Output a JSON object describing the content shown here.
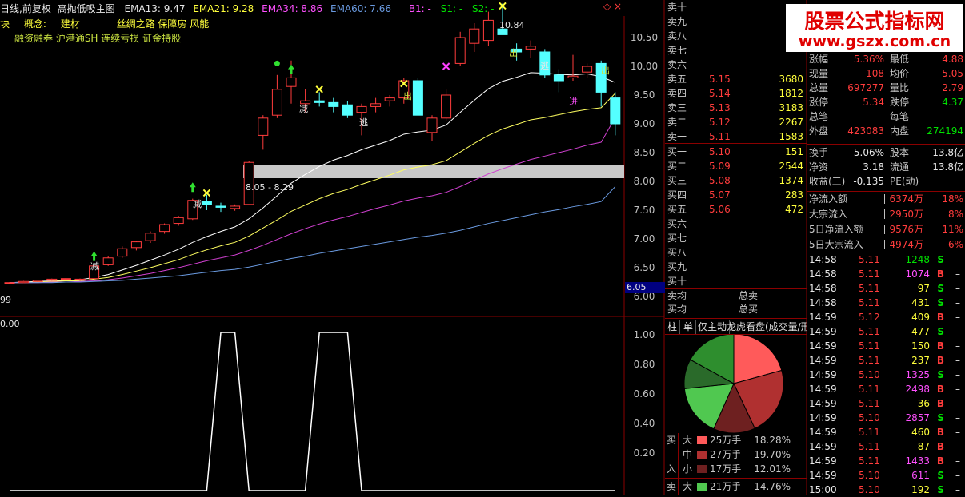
{
  "header": {
    "period": "日线,前复权",
    "indicator": "高抛低吸主图",
    "ema13": "EMA13: 9.47",
    "ema21": "EMA21: 9.28",
    "ema34": "EMA34: 8.86",
    "ema60": "EMA60: 7.66",
    "b1": "B1: -",
    "s1": "S1: -",
    "s2": "S2: -",
    "controls": "◇ ×"
  },
  "info": {
    "row1_a": "块",
    "row1_b": "概念:",
    "row1_c": "建材",
    "row1_d": "丝绸之路 保障房 风能",
    "row2": "融资融券 沪港通SH 连续亏损 证金持股"
  },
  "chart_labels": {
    "high_label": "10.84",
    "zone_label": "8.05 - 8.29",
    "left_value": "99",
    "sub_title": "0.00",
    "price_tag": "6.05",
    "marks": {
      "jian": "减",
      "tao": "逃",
      "chu": "出",
      "jin": "进"
    }
  },
  "watermark": {
    "title": "股票公式指标网",
    "url": "www.gszx.com.cn"
  },
  "price_axis": [
    "10.50",
    "10.00",
    "9.50",
    "9.00",
    "8.50",
    "8.00",
    "7.50",
    "7.00",
    "6.50",
    "6.00"
  ],
  "sub_axis": [
    "1.00",
    "0.80",
    "0.60",
    "0.40",
    "0.20"
  ],
  "orderbook": {
    "sells": [
      {
        "label": "卖十",
        "price": "",
        "vol": ""
      },
      {
        "label": "卖九",
        "price": "",
        "vol": ""
      },
      {
        "label": "卖八",
        "price": "",
        "vol": ""
      },
      {
        "label": "卖七",
        "price": "",
        "vol": ""
      },
      {
        "label": "卖六",
        "price": "",
        "vol": ""
      },
      {
        "label": "卖五",
        "price": "5.15",
        "vol": "3680"
      },
      {
        "label": "卖四",
        "price": "5.14",
        "vol": "1812"
      },
      {
        "label": "卖三",
        "price": "5.13",
        "vol": "3183"
      },
      {
        "label": "卖二",
        "price": "5.12",
        "vol": "2267"
      },
      {
        "label": "卖一",
        "price": "5.11",
        "vol": "1583"
      }
    ],
    "buys": [
      {
        "label": "买一",
        "price": "5.10",
        "vol": "151"
      },
      {
        "label": "买二",
        "price": "5.09",
        "vol": "2544"
      },
      {
        "label": "买三",
        "price": "5.08",
        "vol": "1374"
      },
      {
        "label": "买四",
        "price": "5.07",
        "vol": "283"
      },
      {
        "label": "买五",
        "price": "5.06",
        "vol": "472"
      },
      {
        "label": "买六",
        "price": "",
        "vol": ""
      },
      {
        "label": "买七",
        "price": "",
        "vol": ""
      },
      {
        "label": "买八",
        "price": "",
        "vol": ""
      },
      {
        "label": "买九",
        "price": "",
        "vol": ""
      },
      {
        "label": "买十",
        "price": "",
        "vol": ""
      }
    ],
    "avg_sell_label": "卖均",
    "total_sell_label": "总卖",
    "avg_buy_label": "买均",
    "total_buy_label": "总买"
  },
  "stats": {
    "r0": {
      "l1": "",
      "v1": "",
      "l2": "",
      "v2": ""
    },
    "r1": {
      "l1": "涨幅",
      "v1": "5.36%",
      "l2": "最低",
      "v2": "4.88"
    },
    "r2": {
      "l1": "现量",
      "v1": "108",
      "l2": "均价",
      "v2": "5.05"
    },
    "r3": {
      "l1": "总量",
      "v1": "697277",
      "l2": "量比",
      "v2": "2.79"
    },
    "r4": {
      "l1": "涨停",
      "v1": "5.34",
      "l2": "跌停",
      "v2": "4.37"
    },
    "r5": {
      "l1": "总笔",
      "v1": "-",
      "l2": "每笔",
      "v2": "-"
    },
    "r6": {
      "l1": "外盘",
      "v1": "423083",
      "l2": "内盘",
      "v2": "274194"
    },
    "r7": {
      "l1": "换手",
      "v1": "5.06%",
      "l2": "股本",
      "v2": "13.8亿"
    },
    "r8": {
      "l1": "净资",
      "v1": "3.18",
      "l2": "流通",
      "v2": "13.8亿"
    },
    "r9": {
      "l1": "收益(三)",
      "v1": "-0.135",
      "l2": "PE(动)",
      "v2": ""
    }
  },
  "flows": [
    {
      "label": "净流入额",
      "amount": "6374万",
      "pct": "18%"
    },
    {
      "label": "大宗流入",
      "amount": "2950万",
      "pct": "8%"
    },
    {
      "label": "5日净流入额",
      "amount": "9576万",
      "pct": "11%"
    },
    {
      "label": "5日大宗流入",
      "amount": "4974万",
      "pct": "6%"
    }
  ],
  "ticks": [
    {
      "time": "14:58",
      "price": "5.11",
      "vol": "1248",
      "side": "S",
      "dir": "green"
    },
    {
      "time": "14:58",
      "price": "5.11",
      "vol": "1074",
      "side": "B",
      "dir": "magenta"
    },
    {
      "time": "14:58",
      "price": "5.11",
      "vol": "97",
      "side": "S",
      "dir": "yellow"
    },
    {
      "time": "14:58",
      "price": "5.11",
      "vol": "431",
      "side": "S",
      "dir": "yellow"
    },
    {
      "time": "14:59",
      "price": "5.12",
      "vol": "409",
      "side": "B",
      "dir": "yellow"
    },
    {
      "time": "14:59",
      "price": "5.11",
      "vol": "477",
      "side": "S",
      "dir": "yellow"
    },
    {
      "time": "14:59",
      "price": "5.11",
      "vol": "150",
      "side": "B",
      "dir": "yellow"
    },
    {
      "time": "14:59",
      "price": "5.11",
      "vol": "237",
      "side": "B",
      "dir": "yellow"
    },
    {
      "time": "14:59",
      "price": "5.10",
      "vol": "1325",
      "side": "S",
      "dir": "magenta"
    },
    {
      "time": "14:59",
      "price": "5.11",
      "vol": "2498",
      "side": "B",
      "dir": "magenta"
    },
    {
      "time": "14:59",
      "price": "5.11",
      "vol": "36",
      "side": "B",
      "dir": "yellow"
    },
    {
      "time": "14:59",
      "price": "5.10",
      "vol": "2857",
      "side": "S",
      "dir": "magenta"
    },
    {
      "time": "14:59",
      "price": "5.11",
      "vol": "460",
      "side": "B",
      "dir": "yellow"
    },
    {
      "time": "14:59",
      "price": "5.11",
      "vol": "87",
      "side": "B",
      "dir": "yellow"
    },
    {
      "time": "14:59",
      "price": "5.11",
      "vol": "1433",
      "side": "B",
      "dir": "magenta"
    },
    {
      "time": "14:59",
      "price": "5.10",
      "vol": "611",
      "side": "S",
      "dir": "magenta"
    },
    {
      "time": "15:00",
      "price": "5.10",
      "vol": "192",
      "side": "S",
      "dir": "yellow"
    }
  ],
  "bottom_tabs": [
    "柱",
    "单",
    "仅主动",
    "龙虎看盘(成交量/形"
  ],
  "pie_legend": {
    "buy_label": "买",
    "in_label": "入",
    "sell_label": "卖",
    "rows": [
      {
        "size": "大",
        "amount": "25万手",
        "pct": "18.28%",
        "color": "#ff5a5a"
      },
      {
        "size": "中",
        "amount": "27万手",
        "pct": "19.70%",
        "color": "#b03030"
      },
      {
        "size": "小",
        "amount": "17万手",
        "pct": "12.01%",
        "color": "#6e2020"
      },
      {
        "size": "大",
        "amount": "21万手",
        "pct": "14.76%",
        "color": "#50c850"
      }
    ]
  },
  "chart_data": [
    {
      "type": "candlestick",
      "title": "高抛低吸主图",
      "y_axis": [
        6.0,
        10.5
      ],
      "ylim": [
        5.8,
        10.9
      ],
      "candles": [
        {
          "o": 5.98,
          "h": 6.0,
          "l": 5.97,
          "c": 5.99
        },
        {
          "o": 5.99,
          "h": 6.02,
          "l": 5.98,
          "c": 6.01
        },
        {
          "o": 6.01,
          "h": 6.04,
          "l": 6.0,
          "c": 6.03
        },
        {
          "o": 6.03,
          "h": 6.06,
          "l": 6.02,
          "c": 6.05
        },
        {
          "o": 6.05,
          "h": 6.07,
          "l": 6.04,
          "c": 6.06
        },
        {
          "o": 6.04,
          "h": 6.06,
          "l": 6.02,
          "c": 6.05
        },
        {
          "o": 6.06,
          "h": 6.3,
          "l": 6.05,
          "c": 6.28
        },
        {
          "o": 6.3,
          "h": 6.45,
          "l": 6.28,
          "c": 6.42
        },
        {
          "o": 6.45,
          "h": 6.62,
          "l": 6.42,
          "c": 6.58
        },
        {
          "o": 6.6,
          "h": 6.72,
          "l": 6.55,
          "c": 6.7
        },
        {
          "o": 6.72,
          "h": 6.88,
          "l": 6.68,
          "c": 6.85
        },
        {
          "o": 6.88,
          "h": 7.02,
          "l": 6.84,
          "c": 7.0
        },
        {
          "o": 7.02,
          "h": 7.15,
          "l": 6.98,
          "c": 7.12
        },
        {
          "o": 7.1,
          "h": 7.45,
          "l": 7.08,
          "c": 7.42
        },
        {
          "o": 7.4,
          "h": 7.52,
          "l": 7.25,
          "c": 7.35
        },
        {
          "o": 7.32,
          "h": 7.38,
          "l": 7.22,
          "c": 7.3
        },
        {
          "o": 7.28,
          "h": 7.35,
          "l": 7.24,
          "c": 7.32
        },
        {
          "o": 7.35,
          "h": 8.1,
          "l": 7.35,
          "c": 8.08
        },
        {
          "o": 8.55,
          "h": 8.9,
          "l": 8.3,
          "c": 8.85
        },
        {
          "o": 8.9,
          "h": 9.6,
          "l": 8.85,
          "c": 9.35
        },
        {
          "o": 9.4,
          "h": 9.85,
          "l": 9.1,
          "c": 9.55
        },
        {
          "o": 9.1,
          "h": 9.35,
          "l": 8.95,
          "c": 9.15
        },
        {
          "o": 9.15,
          "h": 9.3,
          "l": 9.05,
          "c": 9.12
        },
        {
          "o": 9.12,
          "h": 9.2,
          "l": 8.95,
          "c": 9.05
        },
        {
          "o": 9.08,
          "h": 9.15,
          "l": 8.85,
          "c": 8.9
        },
        {
          "o": 8.95,
          "h": 9.1,
          "l": 8.55,
          "c": 9.05
        },
        {
          "o": 9.05,
          "h": 9.2,
          "l": 8.95,
          "c": 9.1
        },
        {
          "o": 9.15,
          "h": 9.25,
          "l": 9.05,
          "c": 9.2
        },
        {
          "o": 9.2,
          "h": 9.55,
          "l": 9.1,
          "c": 9.5
        },
        {
          "o": 9.5,
          "h": 9.55,
          "l": 8.9,
          "c": 8.9
        },
        {
          "o": 8.6,
          "h": 8.9,
          "l": 8.45,
          "c": 8.85
        },
        {
          "o": 8.85,
          "h": 9.35,
          "l": 8.8,
          "c": 9.25
        },
        {
          "o": 9.8,
          "h": 10.35,
          "l": 9.75,
          "c": 10.25
        },
        {
          "o": 10.15,
          "h": 10.5,
          "l": 10.0,
          "c": 10.4
        },
        {
          "o": 10.2,
          "h": 10.7,
          "l": 10.1,
          "c": 10.55
        },
        {
          "o": 10.4,
          "h": 10.84,
          "l": 10.35,
          "c": 10.3
        },
        {
          "o": 10.05,
          "h": 10.15,
          "l": 9.85,
          "c": 10.0
        },
        {
          "o": 10.05,
          "h": 10.2,
          "l": 9.9,
          "c": 10.1
        },
        {
          "o": 10.0,
          "h": 10.05,
          "l": 9.55,
          "c": 9.6
        },
        {
          "o": 9.6,
          "h": 9.7,
          "l": 9.3,
          "c": 9.5
        },
        {
          "o": 9.55,
          "h": 9.95,
          "l": 9.5,
          "c": 9.58
        },
        {
          "o": 9.65,
          "h": 9.8,
          "l": 9.55,
          "c": 9.75
        },
        {
          "o": 9.8,
          "h": 9.85,
          "l": 9.05,
          "c": 9.3
        },
        {
          "o": 9.2,
          "h": 9.3,
          "l": 8.55,
          "c": 8.75
        }
      ],
      "series": [
        {
          "name": "EMA13",
          "color": "#ffffff",
          "values": [
            5.99,
            6.0,
            6.01,
            6.02,
            6.03,
            6.04,
            6.08,
            6.13,
            6.21,
            6.29,
            6.38,
            6.47,
            6.57,
            6.69,
            6.79,
            6.88,
            6.96,
            7.1,
            7.29,
            7.5,
            7.72,
            7.87,
            8.01,
            8.12,
            8.2,
            8.3,
            8.38,
            8.46,
            8.57,
            8.61,
            8.64,
            8.73,
            8.95,
            9.16,
            9.36,
            9.49,
            9.56,
            9.64,
            9.63,
            9.61,
            9.6,
            9.62,
            9.57,
            9.47
          ]
        },
        {
          "name": "EMA21",
          "color": "#ffff60",
          "values": [
            5.99,
            5.99,
            6.0,
            6.01,
            6.02,
            6.02,
            6.05,
            6.08,
            6.13,
            6.19,
            6.25,
            6.32,
            6.39,
            6.48,
            6.56,
            6.63,
            6.69,
            6.8,
            6.94,
            7.08,
            7.23,
            7.34,
            7.45,
            7.54,
            7.61,
            7.7,
            7.78,
            7.86,
            7.95,
            8.0,
            8.04,
            8.11,
            8.26,
            8.41,
            8.55,
            8.66,
            8.74,
            8.82,
            8.86,
            8.91,
            8.96,
            9.0,
            9.03,
            9.28
          ]
        },
        {
          "name": "EMA34",
          "color": "#d040d0",
          "values": [
            5.99,
            5.99,
            5.99,
            6.0,
            6.0,
            6.01,
            6.02,
            6.04,
            6.07,
            6.11,
            6.15,
            6.2,
            6.25,
            6.31,
            6.37,
            6.42,
            6.47,
            6.55,
            6.64,
            6.74,
            6.84,
            6.93,
            7.01,
            7.08,
            7.14,
            7.21,
            7.28,
            7.34,
            7.41,
            7.46,
            7.5,
            7.56,
            7.66,
            7.77,
            7.88,
            7.97,
            8.05,
            8.13,
            8.19,
            8.25,
            8.31,
            8.38,
            8.43,
            8.86
          ]
        },
        {
          "name": "EMA60",
          "color": "#6a9ae0",
          "values": [
            5.99,
            5.99,
            5.99,
            5.99,
            6.0,
            6.0,
            6.01,
            6.02,
            6.03,
            6.05,
            6.07,
            6.09,
            6.11,
            6.14,
            6.17,
            6.2,
            6.22,
            6.26,
            6.31,
            6.36,
            6.41,
            6.45,
            6.5,
            6.54,
            6.58,
            6.62,
            6.66,
            6.7,
            6.74,
            6.78,
            6.81,
            6.85,
            6.9,
            6.96,
            7.02,
            7.07,
            7.12,
            7.17,
            7.22,
            7.26,
            7.31,
            7.35,
            7.4,
            7.66
          ]
        }
      ]
    },
    {
      "type": "line",
      "title": "",
      "ylim": [
        0,
        1.0
      ],
      "series": [
        {
          "name": "",
          "color": "#ffffff",
          "values": [
            0,
            0,
            0,
            0,
            0,
            0,
            0,
            0,
            0,
            0,
            0,
            0,
            0,
            0,
            0,
            1,
            1,
            0,
            0,
            0,
            0,
            0,
            1,
            1,
            1,
            0,
            0,
            0,
            0,
            0,
            0,
            0,
            0,
            0,
            0,
            0,
            0,
            0,
            0,
            0,
            0,
            0,
            0,
            0
          ]
        }
      ]
    },
    {
      "type": "pie",
      "title": "",
      "values": [
        18.28,
        19.7,
        12.01,
        14.76,
        8.5,
        15.0
      ],
      "colors": [
        "#ff5a5a",
        "#b03030",
        "#6e2020",
        "#50c850",
        "#2a6a2a",
        "#2e8e2e"
      ]
    }
  ]
}
